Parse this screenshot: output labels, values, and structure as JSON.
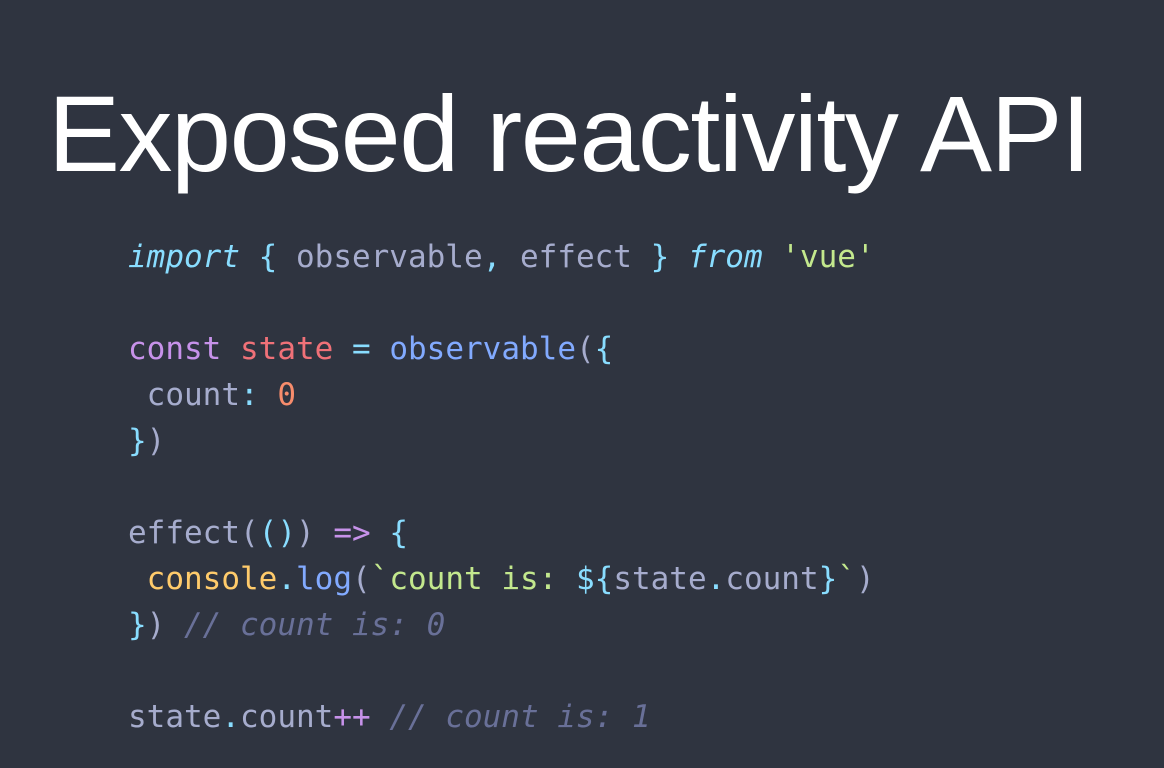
{
  "slide": {
    "title": "Exposed reactivity API",
    "background_color": "#2f3440",
    "title_color": "#ffffff"
  },
  "code": {
    "language": "javascript",
    "full_text": "import { observable, effect } from 'vue'\n\nconst state = observable({\n count: 0\n})\n\neffect(() => {\n console.log(`count is: ${state.count}`)\n}) // count is: 0\n\nstate.count++ // count is: 1",
    "lines": [
      {
        "id": "line-1",
        "tokens": [
          {
            "text": "import",
            "type": "keyword"
          },
          {
            "text": " ",
            "type": "plain"
          },
          {
            "text": "{",
            "type": "punct"
          },
          {
            "text": " observable",
            "type": "plain"
          },
          {
            "text": ",",
            "type": "punct"
          },
          {
            "text": " effect ",
            "type": "plain"
          },
          {
            "text": "}",
            "type": "punct"
          },
          {
            "text": " ",
            "type": "plain"
          },
          {
            "text": "from",
            "type": "keyword"
          },
          {
            "text": " ",
            "type": "plain"
          },
          {
            "text": "'vue'",
            "type": "string"
          }
        ]
      },
      {
        "id": "line-2",
        "tokens": []
      },
      {
        "id": "line-3",
        "tokens": [
          {
            "text": "const",
            "type": "declare"
          },
          {
            "text": " ",
            "type": "plain"
          },
          {
            "text": "state",
            "type": "variable"
          },
          {
            "text": " ",
            "type": "plain"
          },
          {
            "text": "=",
            "type": "punct"
          },
          {
            "text": " ",
            "type": "plain"
          },
          {
            "text": "observable",
            "type": "function"
          },
          {
            "text": "(",
            "type": "paren"
          },
          {
            "text": "{",
            "type": "punct"
          }
        ]
      },
      {
        "id": "line-4",
        "tokens": [
          {
            "text": " count",
            "type": "plain"
          },
          {
            "text": ":",
            "type": "punct"
          },
          {
            "text": " ",
            "type": "plain"
          },
          {
            "text": "0",
            "type": "number"
          }
        ]
      },
      {
        "id": "line-5",
        "tokens": [
          {
            "text": "}",
            "type": "punct"
          },
          {
            "text": ")",
            "type": "paren"
          }
        ]
      },
      {
        "id": "line-6",
        "tokens": []
      },
      {
        "id": "line-7",
        "tokens": [
          {
            "text": "effect",
            "type": "plain"
          },
          {
            "text": "(",
            "type": "paren"
          },
          {
            "text": "()",
            "type": "punct"
          },
          {
            "text": ")",
            "type": "paren"
          },
          {
            "text": " ",
            "type": "plain"
          },
          {
            "text": "=>",
            "type": "operator"
          },
          {
            "text": " ",
            "type": "plain"
          },
          {
            "text": "{",
            "type": "punct"
          }
        ]
      },
      {
        "id": "line-8",
        "tokens": [
          {
            "text": " ",
            "type": "plain"
          },
          {
            "text": "console",
            "type": "object"
          },
          {
            "text": ".",
            "type": "punct"
          },
          {
            "text": "log",
            "type": "function"
          },
          {
            "text": "(",
            "type": "paren"
          },
          {
            "text": "`count is: ",
            "type": "string"
          },
          {
            "text": "${",
            "type": "punct"
          },
          {
            "text": "state",
            "type": "plain"
          },
          {
            "text": ".",
            "type": "punct"
          },
          {
            "text": "count",
            "type": "plain"
          },
          {
            "text": "}",
            "type": "punct"
          },
          {
            "text": "`",
            "type": "string"
          },
          {
            "text": ")",
            "type": "paren"
          }
        ]
      },
      {
        "id": "line-9",
        "tokens": [
          {
            "text": "}",
            "type": "punct"
          },
          {
            "text": ")",
            "type": "paren"
          },
          {
            "text": " ",
            "type": "plain"
          },
          {
            "text": "// count is: 0",
            "type": "comment"
          }
        ]
      },
      {
        "id": "line-10",
        "tokens": []
      },
      {
        "id": "line-11",
        "tokens": [
          {
            "text": "state",
            "type": "plain"
          },
          {
            "text": ".",
            "type": "punct"
          },
          {
            "text": "count",
            "type": "plain"
          },
          {
            "text": "++",
            "type": "operator"
          },
          {
            "text": " ",
            "type": "plain"
          },
          {
            "text": "// count is: 1",
            "type": "comment"
          }
        ]
      }
    ]
  },
  "syntax_colors": {
    "keyword": "#89ddff",
    "declare": "#c792ea",
    "variable": "#f07178",
    "function": "#82aaff",
    "plain": "#a6accd",
    "punct": "#89ddff",
    "paren": "#a6accd",
    "string": "#c3e88d",
    "number": "#f78c6c",
    "object": "#ffcb6b",
    "operator": "#c792ea",
    "comment": "#697098"
  }
}
